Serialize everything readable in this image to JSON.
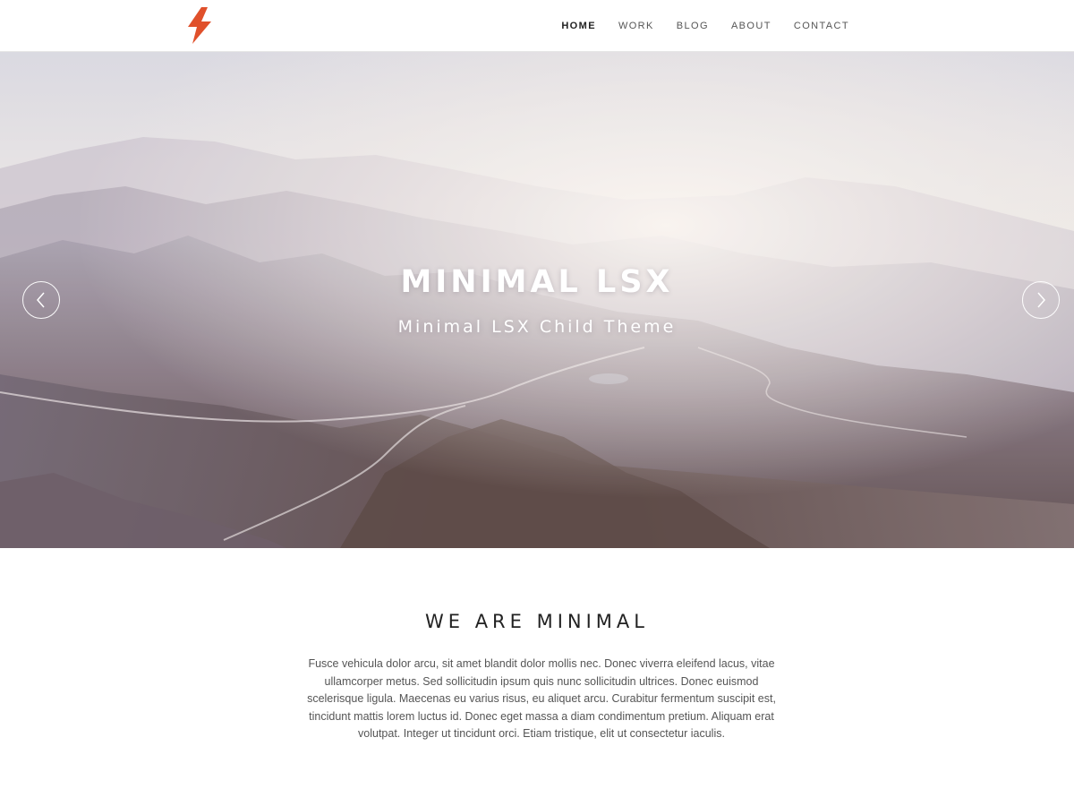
{
  "header": {
    "logo_icon": "lightning-bolt-icon",
    "logo_color": "#e0502b",
    "nav": [
      {
        "label": "HOME",
        "active": true
      },
      {
        "label": "WORK",
        "active": false
      },
      {
        "label": "BLOG",
        "active": false
      },
      {
        "label": "ABOUT",
        "active": false
      },
      {
        "label": "CONTACT",
        "active": false
      }
    ]
  },
  "hero": {
    "title": "MINIMAL LSX",
    "subtitle": "Minimal LSX Child Theme",
    "prev_icon": "chevron-left-icon",
    "next_icon": "chevron-right-icon"
  },
  "intro": {
    "heading": "WE ARE MINIMAL",
    "body": "Fusce vehicula dolor arcu, sit amet blandit dolor mollis nec. Donec viverra eleifend lacus, vitae ullamcorper metus. Sed sollicitudin ipsum quis nunc sollicitudin ultrices. Donec euismod scelerisque ligula. Maecenas eu varius risus, eu aliquet arcu. Curabitur fermentum suscipit est, tincidunt mattis lorem luctus id. Donec eget massa a diam condimentum pretium. Aliquam erat volutpat. Integer ut tincidunt orci. Etiam tristique, elit ut consectetur iaculis."
  }
}
